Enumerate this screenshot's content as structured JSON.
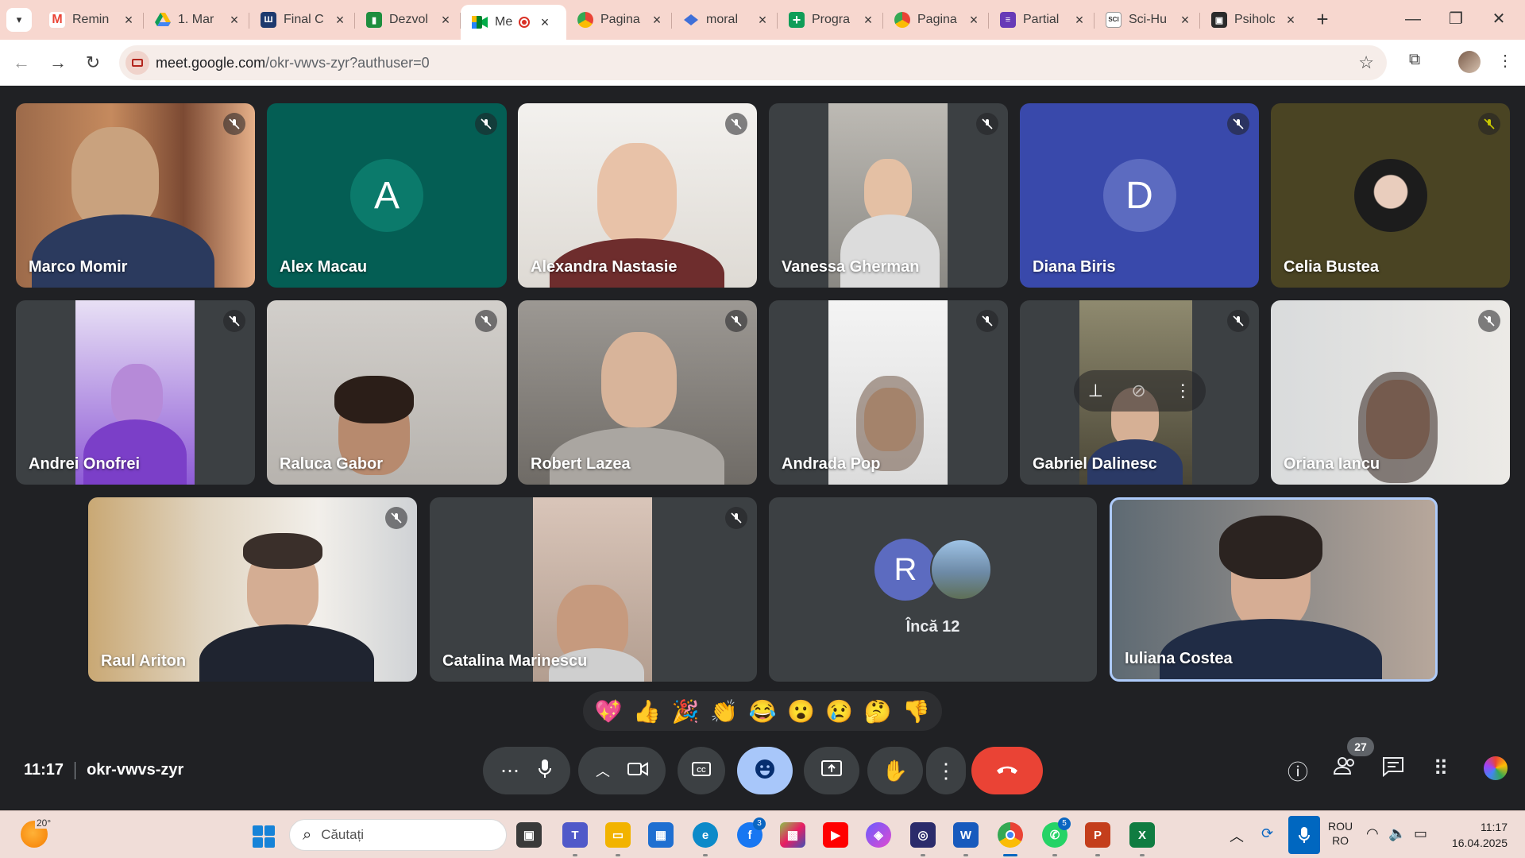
{
  "browser": {
    "tabs": [
      {
        "title": "Remin",
        "favicon": "gmail-icon"
      },
      {
        "title": "1. Mar",
        "favicon": "drive-icon"
      },
      {
        "title": "Final C",
        "favicon": "doc-icon"
      },
      {
        "title": "Dezvol",
        "favicon": "classroom-icon"
      },
      {
        "title": "Me",
        "favicon": "meet-icon",
        "active": true
      },
      {
        "title": "Pagina",
        "favicon": "chrome-icon"
      },
      {
        "title": "moral",
        "favicon": "gem-icon"
      },
      {
        "title": "Progra",
        "favicon": "sheets-plus-icon"
      },
      {
        "title": "Pagina",
        "favicon": "chrome-icon"
      },
      {
        "title": "Partial",
        "favicon": "forms-icon"
      },
      {
        "title": "Sci-Hu",
        "favicon": "scihub-icon"
      },
      {
        "title": "Psiholc",
        "favicon": "profile-icon"
      }
    ],
    "url_host": "meet.google.com",
    "url_path": "/okr-vwvs-zyr?authuser=0"
  },
  "participants": [
    {
      "name": "Marco Momir"
    },
    {
      "name": "Alex Macau",
      "letter": "A"
    },
    {
      "name": "Alexandra Nastasie"
    },
    {
      "name": "Vanessa Gherman"
    },
    {
      "name": "Diana Biris",
      "letter": "D"
    },
    {
      "name": "Celia Bustea"
    },
    {
      "name": "Andrei Onofrei"
    },
    {
      "name": "Raluca Gabor"
    },
    {
      "name": "Robert Lazea"
    },
    {
      "name": "Andrada Pop"
    },
    {
      "name": "Gabriel Dalinesc"
    },
    {
      "name": "Oriana Iancu"
    },
    {
      "name": "Raul Ariton"
    },
    {
      "name": "Catalina Marinescu"
    },
    {
      "name": "Iuliana Costea"
    }
  ],
  "more": {
    "letter": "R",
    "label": "Încă 12"
  },
  "reactions": [
    "💖",
    "👍",
    "🎉",
    "👏",
    "😂",
    "😮",
    "😢",
    "🤔",
    "👎"
  ],
  "meeting": {
    "time": "11:17",
    "code": "okr-vwvs-zyr",
    "people_count": "27"
  },
  "taskbar": {
    "weather_temp": "20°",
    "search_placeholder": "Căutați",
    "lang_top": "ROU",
    "lang_bottom": "RO",
    "time": "11:17",
    "date": "16.04.2025",
    "badge_facebook": "3",
    "badge_whatsapp": "5"
  },
  "colors": {
    "meet_bg": "#202124",
    "tile_bg": "#3c4043",
    "end_call": "#ea4335",
    "active_ctrl": "#a8c7fa",
    "tabbar": "#f7d7cf"
  }
}
